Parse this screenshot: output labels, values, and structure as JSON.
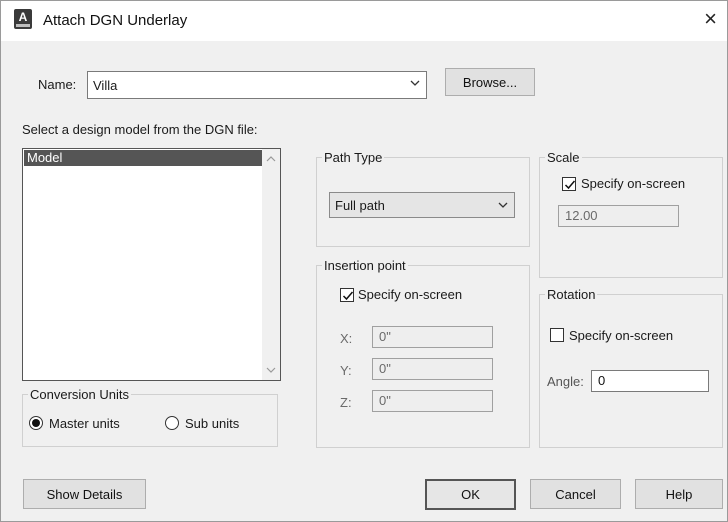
{
  "window": {
    "title": "Attach DGN Underlay",
    "close_glyph": "×"
  },
  "name_row": {
    "label": "Name:",
    "value": "Villa",
    "browse_label": "Browse..."
  },
  "model_list": {
    "heading": "Select a design model from the DGN file:",
    "items": [
      "Model"
    ]
  },
  "conversion_units": {
    "title": "Conversion Units",
    "options": [
      {
        "label": "Master units",
        "selected": true
      },
      {
        "label": "Sub units",
        "selected": false
      }
    ]
  },
  "path_type": {
    "title": "Path Type",
    "value": "Full path"
  },
  "insertion_point": {
    "title": "Insertion point",
    "specify_label": "Specify on-screen",
    "specify_checked": true,
    "x_label": "X:",
    "x_value": "0\"",
    "y_label": "Y:",
    "y_value": "0\"",
    "z_label": "Z:",
    "z_value": "0\""
  },
  "scale": {
    "title": "Scale",
    "specify_label": "Specify on-screen",
    "specify_checked": true,
    "value": "12.00"
  },
  "rotation": {
    "title": "Rotation",
    "specify_label": "Specify on-screen",
    "specify_checked": false,
    "angle_label": "Angle:",
    "angle_value": "0"
  },
  "buttons": {
    "show_details": "Show Details",
    "ok": "OK",
    "cancel": "Cancel",
    "help": "Help"
  },
  "icons": {
    "app": "autocad-app-icon",
    "check": "check-icon",
    "chevron": "chevron-down-icon",
    "close": "close-icon"
  }
}
